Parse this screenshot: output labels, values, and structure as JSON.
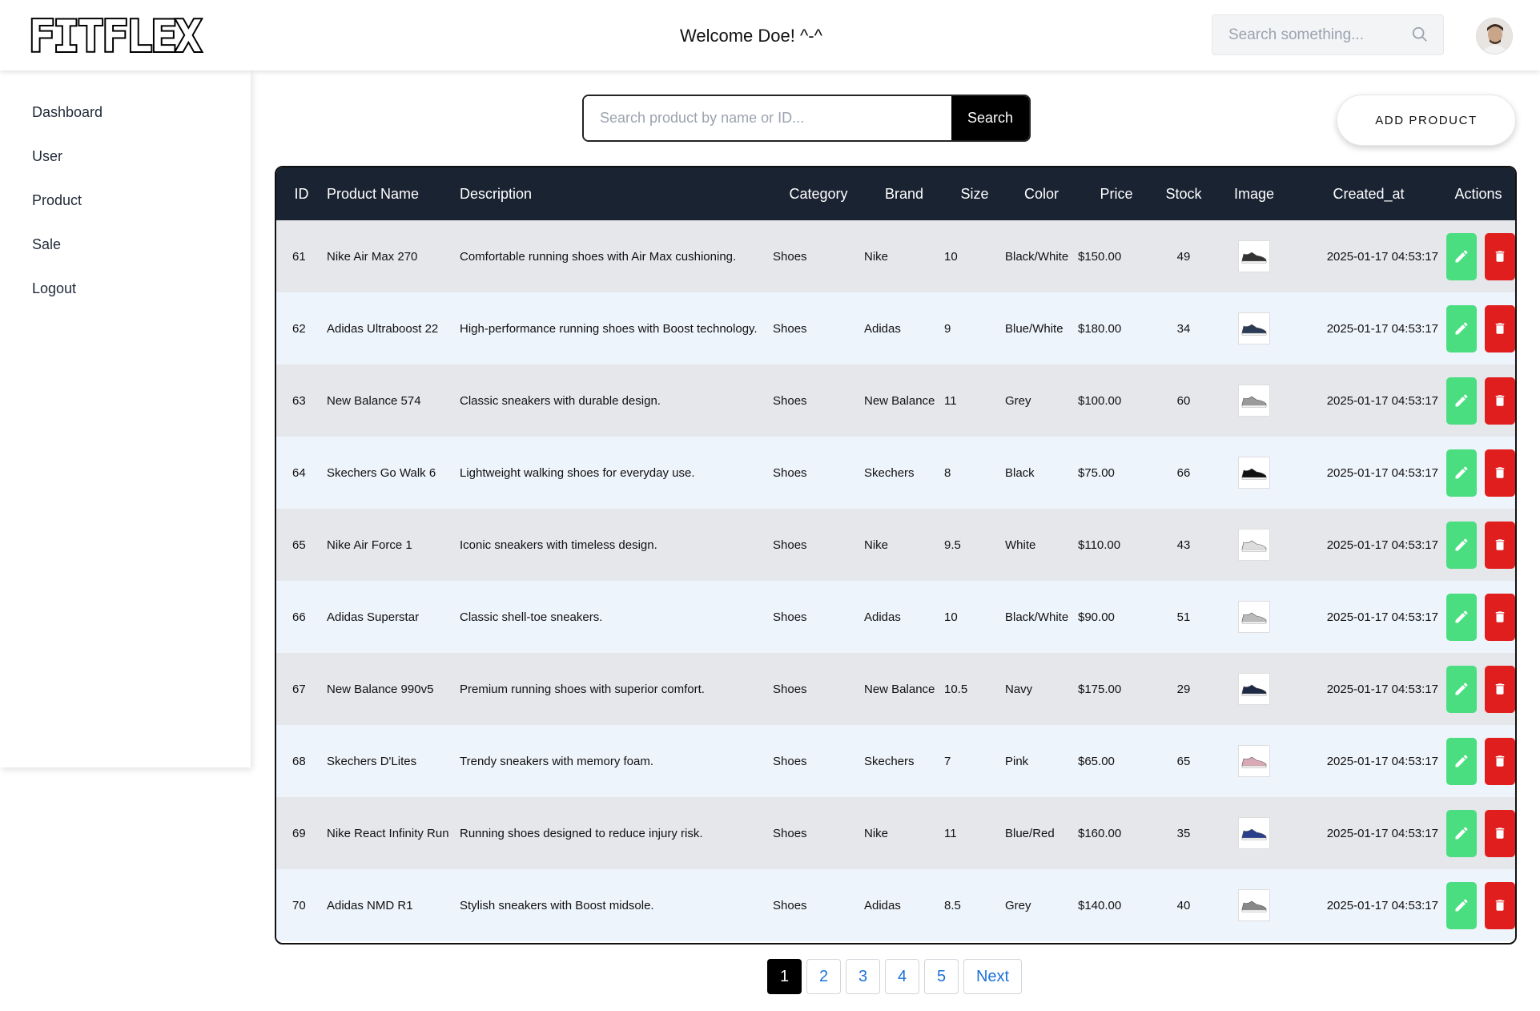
{
  "header": {
    "logo_text": "FITFLEX",
    "welcome": "Welcome Doe! ^-^",
    "search_placeholder": "Search something..."
  },
  "sidebar": {
    "items": [
      {
        "label": "Dashboard"
      },
      {
        "label": "User"
      },
      {
        "label": "Product"
      },
      {
        "label": "Sale"
      },
      {
        "label": "Logout"
      }
    ]
  },
  "product_search": {
    "placeholder": "Search product by name or ID...",
    "button": "Search"
  },
  "add_button": "ADD PRODUCT",
  "table": {
    "headers": [
      "ID",
      "Product Name",
      "Description",
      "Category",
      "Brand",
      "Size",
      "Color",
      "Price",
      "Stock",
      "Image",
      "Created_at",
      "Actions"
    ],
    "rows": [
      {
        "id": "61",
        "name": "Nike Air Max 270",
        "description": "Comfortable running shoes with Air Max cushioning.",
        "category": "Shoes",
        "brand": "Nike",
        "size": "10",
        "color": "Black/White",
        "price": "$150.00",
        "stock": "49",
        "created_at": "2025-01-17 04:53:17",
        "shoe_color": "#333333"
      },
      {
        "id": "62",
        "name": "Adidas Ultraboost 22",
        "description": "High-performance running shoes with Boost technology.",
        "category": "Shoes",
        "brand": "Adidas",
        "size": "9",
        "color": "Blue/White",
        "price": "$180.00",
        "stock": "34",
        "created_at": "2025-01-17 04:53:17",
        "shoe_color": "#2b3a55"
      },
      {
        "id": "63",
        "name": "New Balance 574",
        "description": "Classic sneakers with durable design.",
        "category": "Shoes",
        "brand": "New Balance",
        "size": "11",
        "color": "Grey",
        "price": "$100.00",
        "stock": "60",
        "created_at": "2025-01-17 04:53:17",
        "shoe_color": "#9a9a9a"
      },
      {
        "id": "64",
        "name": "Skechers Go Walk 6",
        "description": "Lightweight walking shoes for everyday use.",
        "category": "Shoes",
        "brand": "Skechers",
        "size": "8",
        "color": "Black",
        "price": "$75.00",
        "stock": "66",
        "created_at": "2025-01-17 04:53:17",
        "shoe_color": "#111111"
      },
      {
        "id": "65",
        "name": "Nike Air Force 1",
        "description": "Iconic sneakers with timeless design.",
        "category": "Shoes",
        "brand": "Nike",
        "size": "9.5",
        "color": "White",
        "price": "$110.00",
        "stock": "43",
        "created_at": "2025-01-17 04:53:17",
        "shoe_color": "#dddddd"
      },
      {
        "id": "66",
        "name": "Adidas Superstar",
        "description": "Classic shell-toe sneakers.",
        "category": "Shoes",
        "brand": "Adidas",
        "size": "10",
        "color": "Black/White",
        "price": "$90.00",
        "stock": "51",
        "created_at": "2025-01-17 04:53:17",
        "shoe_color": "#bbbbbb"
      },
      {
        "id": "67",
        "name": "New Balance 990v5",
        "description": "Premium running shoes with superior comfort.",
        "category": "Shoes",
        "brand": "New Balance",
        "size": "10.5",
        "color": "Navy",
        "price": "$175.00",
        "stock": "29",
        "created_at": "2025-01-17 04:53:17",
        "shoe_color": "#1e2a44"
      },
      {
        "id": "68",
        "name": "Skechers D'Lites",
        "description": "Trendy sneakers with memory foam.",
        "category": "Shoes",
        "brand": "Skechers",
        "size": "7",
        "color": "Pink",
        "price": "$65.00",
        "stock": "65",
        "created_at": "2025-01-17 04:53:17",
        "shoe_color": "#d9a9b5"
      },
      {
        "id": "69",
        "name": "Nike React Infinity Run",
        "description": "Running shoes designed to reduce injury risk.",
        "category": "Shoes",
        "brand": "Nike",
        "size": "11",
        "color": "Blue/Red",
        "price": "$160.00",
        "stock": "35",
        "created_at": "2025-01-17 04:53:17",
        "shoe_color": "#2a3f8a"
      },
      {
        "id": "70",
        "name": "Adidas NMD R1",
        "description": "Stylish sneakers with Boost midsole.",
        "category": "Shoes",
        "brand": "Adidas",
        "size": "8.5",
        "color": "Grey",
        "price": "$140.00",
        "stock": "40",
        "created_at": "2025-01-17 04:53:17",
        "shoe_color": "#888888"
      }
    ]
  },
  "pagination": {
    "pages": [
      "1",
      "2",
      "3",
      "4",
      "5"
    ],
    "active": "1",
    "next": "Next"
  },
  "icons": {
    "edit": "pencil-icon",
    "delete": "trash-icon",
    "search": "search-icon"
  },
  "colors": {
    "header_bg": "#1a2332",
    "edit": "#4ade80",
    "delete": "#e01e1e"
  }
}
